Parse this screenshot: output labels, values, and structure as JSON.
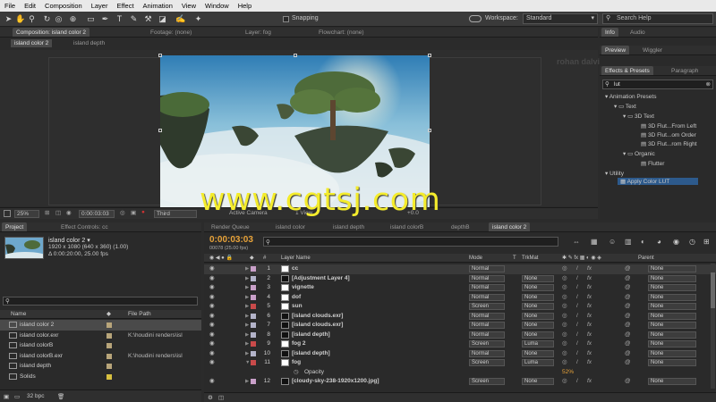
{
  "menu": [
    "File",
    "Edit",
    "Composition",
    "Layer",
    "Effect",
    "Animation",
    "View",
    "Window",
    "Help"
  ],
  "toolbar": {
    "snapping": "Snapping",
    "workspace_label": "Workspace:",
    "workspace_value": "Standard",
    "search_placeholder": "Search Help"
  },
  "comp_panel": {
    "tabs": [
      "Composition: island color 2",
      "Footage: (none)",
      "Layer: fog",
      "Flowchart: (none)"
    ],
    "subtabs": [
      "island color 2",
      "island depth"
    ],
    "zoom": "25%",
    "timecode": "0:00:03:03",
    "resolution": "Third",
    "bottom_text": [
      "Active Camera",
      "1 View",
      "+0.0"
    ]
  },
  "right_panel": {
    "tabs_top": [
      "Info",
      "Audio"
    ],
    "tabs_mid": [
      "Preview",
      "Wiggler"
    ],
    "tabs_effects": [
      "Effects & Presets",
      "Paragraph"
    ],
    "search_value": "lut",
    "tree": [
      "Animation Presets",
      "Text",
      "3D Text",
      "3D Flut...From Left",
      "3D Flut...om Order",
      "3D Flut...rom Right",
      "Organic",
      "Flutter",
      "Utility",
      "Apply Color LUT"
    ]
  },
  "watermark": "www.cgtsj.com",
  "faint_watermark": "rohan dalvi works",
  "project_panel": {
    "tabs": [
      "Project",
      "Effect Controls: cc"
    ],
    "comp_name": "island color 2 ▾",
    "comp_res": "1920 x 1080  (640 x 360) (1.00)",
    "comp_dur": "Δ 0:00:20:00, 25.00 fps",
    "col_name": "Name",
    "col_path": "File Path",
    "items": [
      {
        "label": "island color 2",
        "path": "",
        "color": "#b8a57a"
      },
      {
        "label": "island color.exr",
        "path": "K:\\houdini renders\\isl",
        "color": "#b8a57a"
      },
      {
        "label": "island colorB",
        "path": "",
        "color": "#b8a57a"
      },
      {
        "label": "island colorB.exr",
        "path": "K:\\houdini renders\\isl",
        "color": "#b8a57a"
      },
      {
        "label": "island depth",
        "path": "",
        "color": "#b8a57a"
      },
      {
        "label": "Solids",
        "path": "",
        "color": "#d8c040"
      }
    ],
    "bpc": "32 bpc"
  },
  "timeline": {
    "tabs": [
      "Render Queue",
      "island color",
      "island depth",
      "island colorB",
      "depthB",
      "island color 2"
    ],
    "timecode": "0:00:03:03",
    "frame_info": "00078 (25.00 fps)",
    "headers": {
      "num": "#",
      "name": "Layer Name",
      "mode": "Mode",
      "t": "T",
      "trkmat": "TrkMat",
      "parent": "Parent"
    },
    "layers": [
      {
        "num": "1",
        "name": "cc",
        "mode": "Normal",
        "trk": "",
        "parent": "None",
        "color": "#c9a0c9"
      },
      {
        "num": "2",
        "name": "[Adjustment Layer 4]",
        "mode": "Normal",
        "trk": "None",
        "parent": "None",
        "color": "#b3b3c9"
      },
      {
        "num": "3",
        "name": "vignette",
        "mode": "Normal",
        "trk": "None",
        "parent": "None",
        "color": "#c9a0c9"
      },
      {
        "num": "4",
        "name": "dof",
        "mode": "Normal",
        "trk": "None",
        "parent": "None",
        "color": "#c9a0c9"
      },
      {
        "num": "5",
        "name": "sun",
        "mode": "Screen",
        "trk": "None",
        "parent": "None",
        "color": "#c94a4a"
      },
      {
        "num": "6",
        "name": "[island clouds.exr]",
        "mode": "Normal",
        "trk": "None",
        "parent": "None",
        "color": "#b3b3c9"
      },
      {
        "num": "7",
        "name": "[island clouds.exr]",
        "mode": "Normal",
        "trk": "None",
        "parent": "None",
        "color": "#b3b3c9"
      },
      {
        "num": "8",
        "name": "[island depth]",
        "mode": "Normal",
        "trk": "None",
        "parent": "None",
        "color": "#b3b3c9"
      },
      {
        "num": "9",
        "name": "fog 2",
        "mode": "Screen",
        "trk": "Luma",
        "parent": "None",
        "color": "#c94a4a"
      },
      {
        "num": "10",
        "name": "[island depth]",
        "mode": "Normal",
        "trk": "None",
        "parent": "None",
        "color": "#b3b3c9"
      },
      {
        "num": "11",
        "name": "fog",
        "mode": "Screen",
        "trk": "Luma",
        "parent": "None",
        "color": "#c94a4a"
      },
      {
        "num": "12",
        "name": "[cloudy-sky-238-1920x1200.jpg]",
        "mode": "Screen",
        "trk": "None",
        "parent": "None",
        "color": "#c9a0c9"
      }
    ],
    "opacity_label": "Opacity",
    "opacity_value": "52%"
  },
  "colors": {
    "accent_orange": "#e8a33a",
    "selection_blue": "#2d5a8c",
    "watermark_yellow": "#f4ec2c"
  }
}
